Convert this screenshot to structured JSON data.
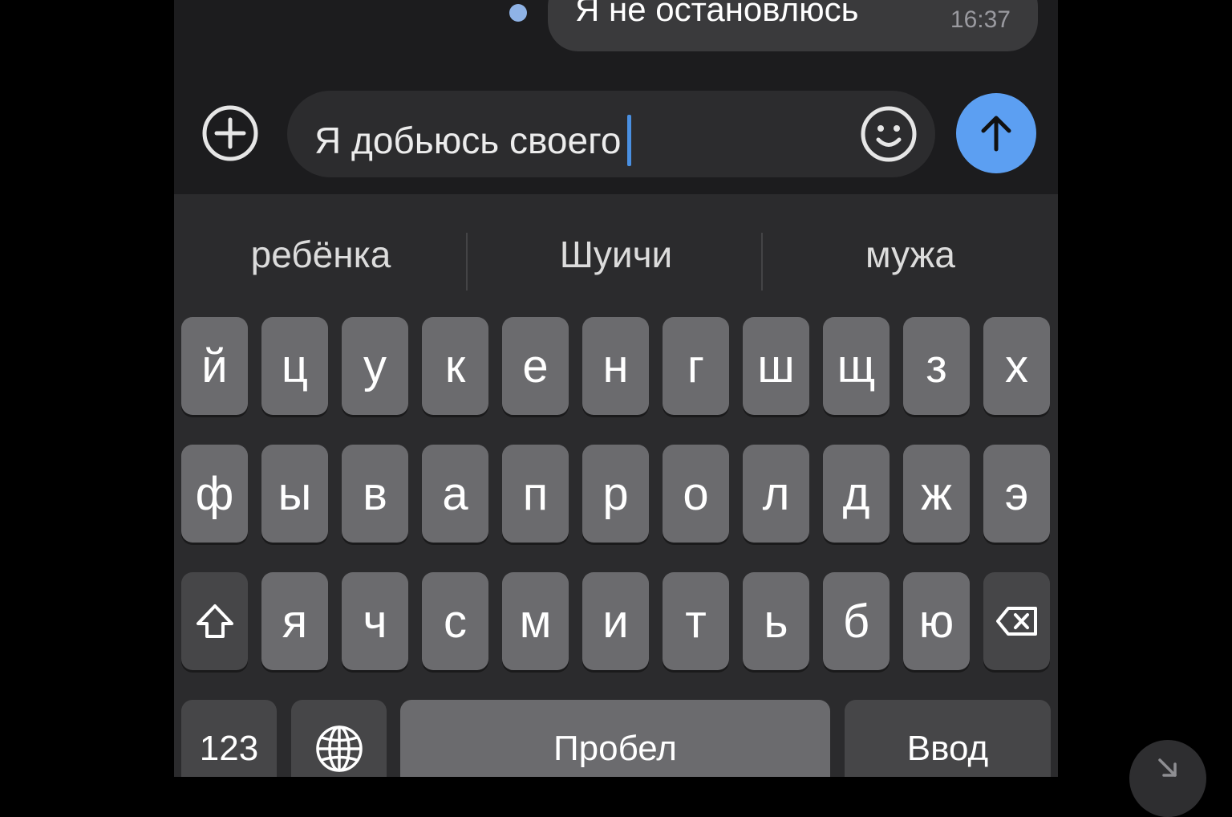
{
  "chat": {
    "message": {
      "text": "Я не остановлюсь",
      "time": "16:37"
    }
  },
  "composer": {
    "input_value": "Я добьюсь своего",
    "add_icon": "plus-circle-icon",
    "emoji_icon": "smiley-icon",
    "send_icon": "arrow-up-icon",
    "send_color": "#5c9ff2"
  },
  "keyboard": {
    "suggestions": [
      "ребёнка",
      "Шуичи",
      "мужа"
    ],
    "rows": [
      [
        "й",
        "ц",
        "у",
        "к",
        "е",
        "н",
        "г",
        "ш",
        "щ",
        "з",
        "х"
      ],
      [
        "ф",
        "ы",
        "в",
        "а",
        "п",
        "р",
        "о",
        "л",
        "д",
        "ж",
        "э"
      ],
      [
        "я",
        "ч",
        "с",
        "м",
        "и",
        "т",
        "ь",
        "б",
        "ю"
      ]
    ],
    "shift_icon": "shift-arrow-icon",
    "backspace_icon": "backspace-icon",
    "numbers_label": "123",
    "globe_icon": "globe-icon",
    "space_label": "Пробел",
    "return_label": "Ввод"
  },
  "overlay": {
    "corner_icon": "diagonal-arrow-icon"
  }
}
